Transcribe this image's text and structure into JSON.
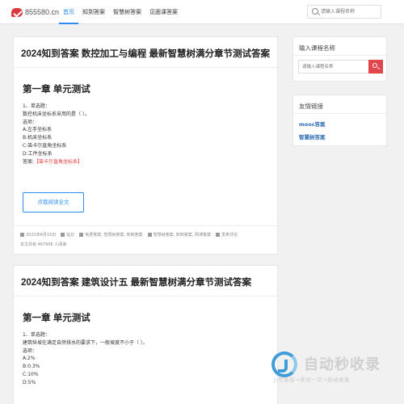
{
  "header": {
    "logo_text": "855580.cn",
    "nav": [
      "首页",
      "知到答案",
      "智慧树答案",
      "见面课答案"
    ],
    "search_placeholder": "请输入课程名称"
  },
  "posts": [
    {
      "title": "2024知到答案 数控加工与编程 最新智慧树满分章节测试答案",
      "chapter": "第一章 单元测试",
      "lines": [
        "1、单选题：",
        "数控机床坐标系采用的是（ ）。",
        "选项：",
        "A:左手坐标系",
        "B:机床坐标系",
        "C:笛卡尔直角坐标系",
        "D:工件坐标系"
      ],
      "answer_label": "答案:",
      "answer": "【笛卡尔直角坐标系】",
      "read_more": "点我阅读全文",
      "meta_date": "2022年6月15日",
      "meta_author": "站长",
      "meta_cats": "免费答案, 智慧树答案, 知到答案",
      "meta_tags": "智慧树答案, 知到答案, 网课答案",
      "meta_comment": "发表评论",
      "meta_views": "本文共有 467906 人阅读"
    },
    {
      "title": "2024知到答案 建筑设计五 最新智慧树满分章节测试答案",
      "chapter": "第一章 单元测试",
      "lines": [
        "1、单选题：",
        "建筑纵坡在满足自然排水的要求下，一般坡度不小于（ ）。",
        "选项：",
        "A:2%",
        "B:0.3%",
        "C:10%",
        "D:5%"
      ]
    }
  ],
  "sidebar": {
    "search_title": "输入课程名称",
    "search_placeholder": "请输入课程名称",
    "links_title": "友情链接",
    "links": [
      "mooc答案",
      "智慧树答案"
    ]
  },
  "watermark": {
    "title": "自动秒收录",
    "subtitle": "上传链接→来访一次→自动收录"
  }
}
